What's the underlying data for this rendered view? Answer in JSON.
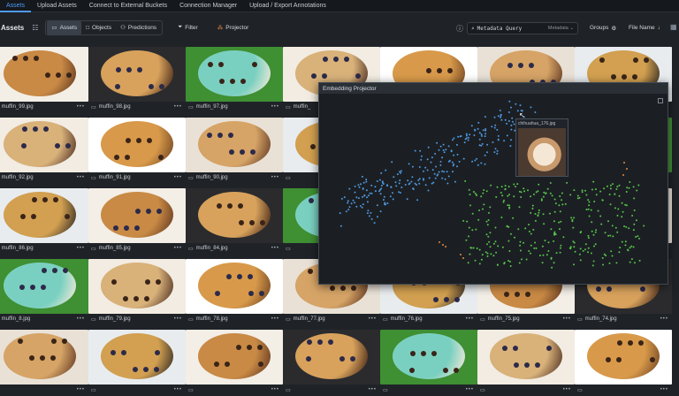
{
  "nav": {
    "tabs": [
      {
        "label": "Assets",
        "active": true
      },
      {
        "label": "Upload Assets"
      },
      {
        "label": "Connect to External Buckets"
      },
      {
        "label": "Connection Manager"
      },
      {
        "label": "Upload / Export Annotations"
      }
    ]
  },
  "toolbar": {
    "title": "Assets",
    "view_tabs": [
      "Assets",
      "Objects",
      "Predictions"
    ],
    "filter_label": "Filter",
    "projector_label": "Projector",
    "search_placeholder": "Metadata Query",
    "search_scope": "Metadata",
    "groups_label": "Groups",
    "sort_label": "File Name"
  },
  "grid": {
    "captions": [
      [
        "muffin_99.jpg",
        "muffin_98.jpg",
        "muffin_97.jpg",
        "muffin_",
        "",
        "",
        ""
      ],
      [
        "muffin_92.jpg",
        "muffin_91.jpg",
        "muffin_90.jpg",
        "",
        "",
        "",
        ""
      ],
      [
        "muffin_86.jpg",
        "muffin_85.jpg",
        "muffin_84.jpg",
        "",
        "",
        "",
        ""
      ],
      [
        "muffin_8.jpg",
        "muffin_79.jpg",
        "muffin_78.jpg",
        "muffin_77.jpg",
        "muffin_76.jpg",
        "muffin_75.jpg",
        "muffin_74.jpg"
      ],
      [
        "",
        "",
        "",
        "",
        "",
        "",
        ""
      ]
    ]
  },
  "projector": {
    "title": "Embedding Projector",
    "tooltip_label": "chihuahua_176.jpg"
  },
  "colors": {
    "accent": "#4f9cf7",
    "blue_points": "#4f97e0",
    "green_points": "#58c54a",
    "orange_points": "#e88a3a"
  }
}
